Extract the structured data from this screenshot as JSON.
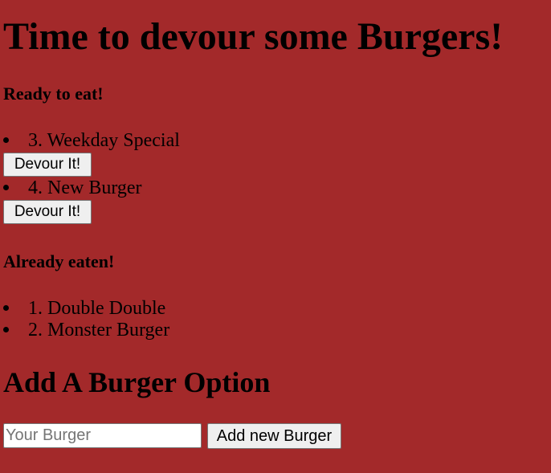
{
  "page": {
    "title": "Time to devour some Burgers!",
    "background_color": "#a3292a"
  },
  "ready": {
    "heading": "Ready to eat!",
    "items": [
      {
        "label": "3. Weekday Special",
        "button_label": "Devour It!"
      },
      {
        "label": "4. New Burger",
        "button_label": "Devour It!"
      }
    ]
  },
  "eaten": {
    "heading": "Already eaten!",
    "items": [
      {
        "label": "1. Double Double"
      },
      {
        "label": "2. Monster Burger"
      }
    ]
  },
  "add_form": {
    "heading": "Add A Burger Option",
    "input_placeholder": "Your Burger",
    "input_value": "",
    "submit_label": "Add new Burger"
  }
}
